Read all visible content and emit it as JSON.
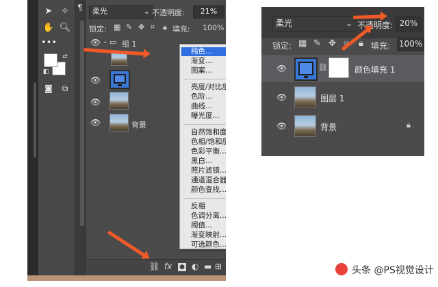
{
  "left_panel": {
    "blend_mode": "柔光",
    "opacity_label": "不透明度:",
    "opacity_value": "21%",
    "lock_label": "锁定:",
    "fill_label": "填充:",
    "fill_value": "100%",
    "group_name": "组 1",
    "background_layer": "背景"
  },
  "context_menu": {
    "items_group1": [
      "纯色...",
      "渐变...",
      "图案..."
    ],
    "items_group2": [
      "亮度/对比度...",
      "色阶...",
      "曲线...",
      "曝光度..."
    ],
    "items_group3": [
      "自然饱和度...",
      "色相/饱和度...",
      "色彩平衡...",
      "黑白...",
      "照片滤镜...",
      "通道混合器...",
      "颜色查找..."
    ],
    "items_group4": [
      "反相",
      "色调分离...",
      "阈值...",
      "渐变映射...",
      "可选颜色..."
    ],
    "highlighted": "纯色..."
  },
  "right_panel": {
    "blend_mode": "柔光",
    "opacity_label": "不透明度:",
    "opacity_value": "20%",
    "lock_label": "锁定:",
    "fill_label": "填充:",
    "fill_value": "100%",
    "layers": [
      "颜色填充 1",
      "图层 1",
      "背景"
    ]
  },
  "watermark": "头条 @PS视觉设计",
  "colors": {
    "accent_arrow": "#f05a28",
    "menu_highlight": "#2f6fe0",
    "fill_color": "#3a78d8"
  }
}
